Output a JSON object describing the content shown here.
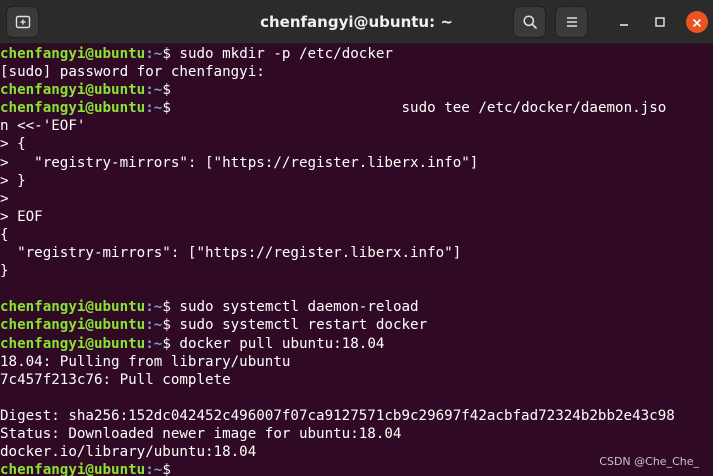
{
  "window": {
    "title": "chenfangyi@ubuntu: ~"
  },
  "prompt": {
    "user_host": "chenfangyi@ubuntu",
    "path": ":~",
    "symbol": "$"
  },
  "terminal": {
    "lines": [
      {
        "prompt": true,
        "cmd": " sudo mkdir -p /etc/docker"
      },
      {
        "text": "[sudo] password for chenfangyi:"
      },
      {
        "prompt": true,
        "cmd": ""
      },
      {
        "prompt": true,
        "cmd": "                           sudo tee /etc/docker/daemon.jso"
      },
      {
        "text": "n <<-'EOF'"
      },
      {
        "text": "> {"
      },
      {
        "text": ">   \"registry-mirrors\": [\"https://register.liberx.info\"]"
      },
      {
        "text": "> }"
      },
      {
        "text": ">"
      },
      {
        "text": "> EOF"
      },
      {
        "text": "{"
      },
      {
        "text": "  \"registry-mirrors\": [\"https://register.liberx.info\"]"
      },
      {
        "text": "}"
      },
      {
        "text": ""
      },
      {
        "prompt": true,
        "cmd": " sudo systemctl daemon-reload"
      },
      {
        "prompt": true,
        "cmd": " sudo systemctl restart docker"
      },
      {
        "prompt": true,
        "cmd": " docker pull ubuntu:18.04"
      },
      {
        "text": "18.04: Pulling from library/ubuntu"
      },
      {
        "text": "7c457f213c76: Pull complete"
      },
      {
        "text": ""
      },
      {
        "text": "Digest: sha256:152dc042452c496007f07ca9127571cb9c29697f42acbfad72324b2bb2e43c98"
      },
      {
        "text": "Status: Downloaded newer image for ubuntu:18.04"
      },
      {
        "text": "docker.io/library/ubuntu:18.04"
      },
      {
        "prompt": true,
        "cmd": " ",
        "cursor": true
      }
    ]
  },
  "watermark": "CSDN @Che_Che_",
  "icons": {
    "new_tab": "new-tab-icon",
    "search": "search-icon",
    "menu": "hamburger-menu-icon",
    "minimize": "minimize-icon",
    "maximize": "maximize-icon",
    "close": "close-icon"
  },
  "colors": {
    "terminal_bg": "#300a24",
    "user_host": "#8ae234",
    "path": "#729fcf",
    "titlebar_bg": "#2b2b2b",
    "close_button": "#e95420"
  }
}
